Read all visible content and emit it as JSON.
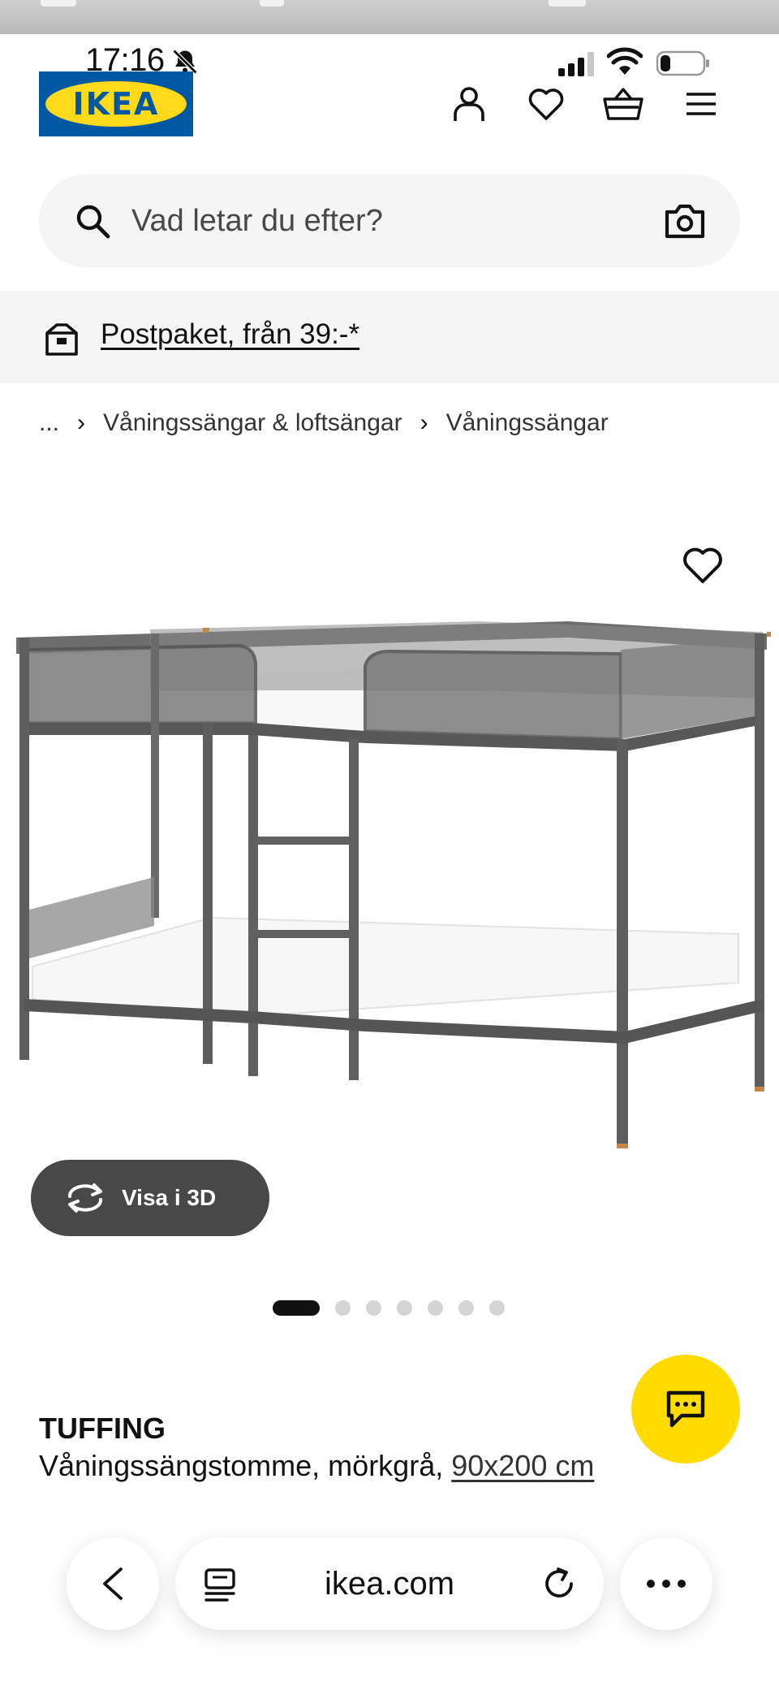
{
  "status": {
    "time": "17:16"
  },
  "header": {
    "logo_text": "IKEA"
  },
  "search": {
    "placeholder": "Vad letar du efter?"
  },
  "promo": {
    "text": "Postpaket, från 39:-*"
  },
  "breadcrumb": {
    "ellipsis": "...",
    "items": [
      "Våningssängar & loftsängar",
      "Våningssängar"
    ]
  },
  "viewer": {
    "button_3d_label": "Visa i 3D",
    "image_count": 7,
    "active_index": 0
  },
  "product": {
    "name": "TUFFING",
    "description": "Våningssängstomme, mörkgrå,",
    "size": "90x200 cm"
  },
  "browser": {
    "url": "ikea.com"
  },
  "colors": {
    "brand_blue": "#0058a3",
    "brand_yellow": "#ffda1a",
    "chat_yellow": "#ffdb00",
    "dark_button": "#484848"
  }
}
